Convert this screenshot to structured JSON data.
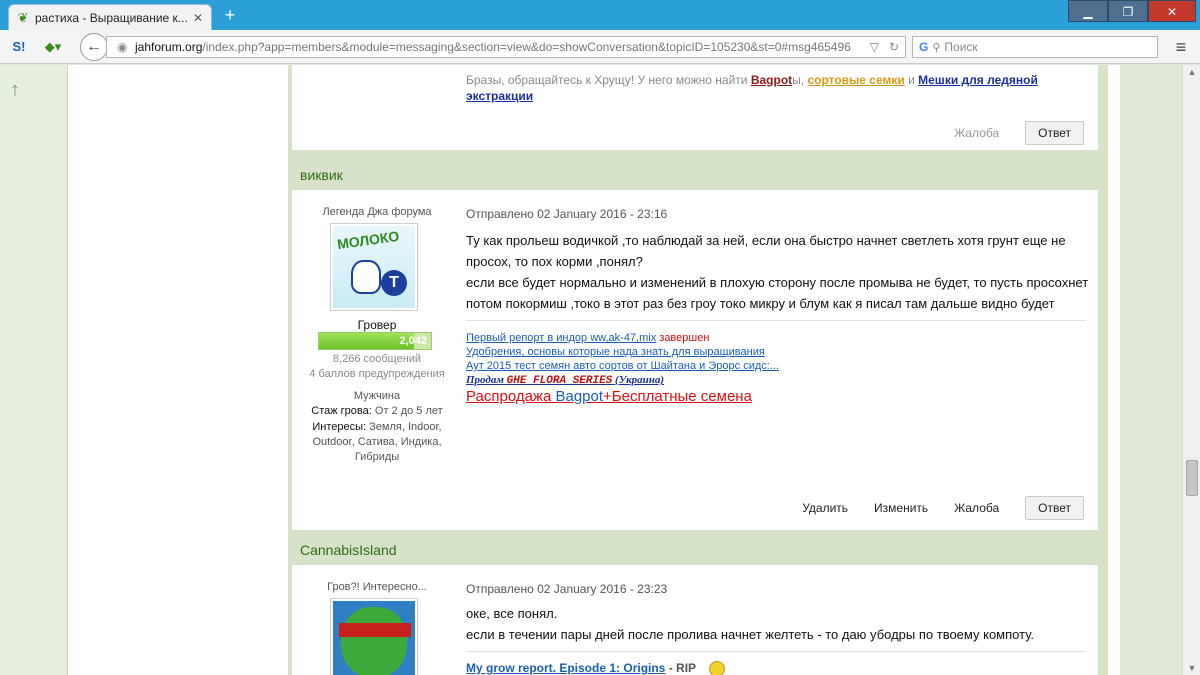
{
  "browser": {
    "tab_title": "растиха - Выращивание к...",
    "url_host": "jahforum.org",
    "url_path": "/index.php?app=members&module=messaging&section=view&do=showConversation&topicID=105230&st=0#msg465496",
    "search_placeholder": "Поиск",
    "new_tab": "+",
    "tab_close": "✕"
  },
  "post0": {
    "sig_prefix": "Бразы, обращайтесь к Хрущу! У него можно найти ",
    "sig_bagpot": "Bagpot",
    "sig_suffix": "ы, ",
    "sig_seeds": "сортовые семки",
    "sig_and": " и ",
    "sig_bags": "Мешки для ледяной экстракции",
    "report": "Жалоба",
    "reply": "Ответ"
  },
  "post1": {
    "author": "виквик",
    "rank": "Легенда Джа форума",
    "avatar_text": "МОЛОКО",
    "group": "Гровер",
    "points": "2,042",
    "points_fraction": 0.85,
    "messages": "8,266 сообщений",
    "warnings": "4 баллов предупреждения",
    "gender": "Мужчина",
    "grow_label": "Стаж грова:",
    "grow_value": "От 2 до 5 лет",
    "interests_label": "Интересы:",
    "interests_value": "Земля, Indoor, Outdoor, Сатива, Индика, Гибриды",
    "date": "Отправлено 02 January 2016 - 23:16",
    "text": [
      "Ту как прольеш водичкой ,то наблюдай за ней, если она быстро начнет светлеть хотя грунт еще не",
      "просох, то пох корми ,понял?",
      "если все будет нормально и изменений в плохую сторону после промыва не будет, то пусть просохнет",
      "потом покормиш ,токо в этот раз без гроу токо микру и блум как я писал там дальше видно будет"
    ],
    "sig_link1": "Первый репорт в индор ww,ak-47,mix",
    "sig_done": " завершен",
    "sig_link2": "Удобрения, основы которые нада знать для выращивания",
    "sig_link3": "Аут 2015 тест семян авто сортов от Шайтана и Эрорс сидс:...",
    "sig_sale_prefix": "Продам ",
    "sig_sale_brand": "GHE FLORA SERIES",
    "sig_sale_suffix": " (Украина)",
    "sig_big_red": "Распродажа ",
    "sig_big_blue": "Bagpot",
    "sig_big_red2": "+Бесплатные семена",
    "delete": "Удалить",
    "edit": "Изменить",
    "report": "Жалоба",
    "reply": "Ответ"
  },
  "post2": {
    "author": "CannabisIsland",
    "rank": "Гров?! Интересно...",
    "date": "Отправлено 02 January 2016 - 23:23",
    "text": [
      "оке, все понял.",
      "если в течении пары дней после пролива начнет желтеть - то даю убодры по твоему компоту."
    ],
    "sig_link": "My grow report. Episode 1: Origins",
    "sig_rip": " - RIP"
  }
}
